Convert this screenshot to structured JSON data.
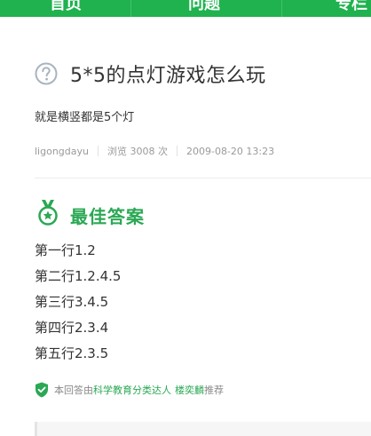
{
  "nav": {
    "tabs": [
      {
        "label": "首页"
      },
      {
        "label": "问题"
      },
      {
        "label": "专栏"
      }
    ]
  },
  "question": {
    "icon": "question-circle-icon",
    "title": "5*5的点灯游戏怎么玩",
    "description": "就是横竖都是5个灯",
    "author": "ligongdayu",
    "views": "浏览 3008 次",
    "date": "2009-08-20 13:23"
  },
  "best_answer": {
    "icon": "medal-icon",
    "heading": "最佳答案",
    "lines": [
      "第一行1.2",
      "第二行1.2.4.5",
      "第三行3.4.5",
      "第四行2.3.4",
      "第五行2.3.5"
    ],
    "recommendation": {
      "icon": "shield-check-icon",
      "prefix": "本回答由",
      "team": "科学教育分类达人",
      "person": "楼奕麟",
      "suffix": "推荐"
    }
  },
  "colors": {
    "brand_green": "#1fb24f",
    "answer_green": "#2aa854",
    "meta_gray": "#9a9a9a"
  }
}
